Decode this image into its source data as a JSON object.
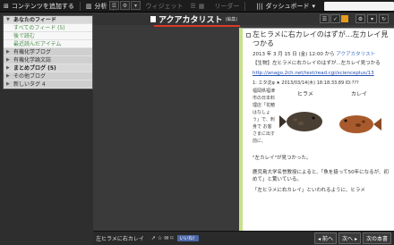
{
  "topbar": {
    "add_content": "コンテンツを追加する",
    "analytics": "分析",
    "widget": "ウィジェット",
    "reader": "リーダー",
    "dashboard": "ダッシュボード"
  },
  "sidebar": {
    "items": [
      {
        "label": "あなたのフィード",
        "style": "head"
      },
      {
        "label": "すべてのフィード (5)",
        "style": "plain"
      },
      {
        "label": "後で読む",
        "style": "plain"
      },
      {
        "label": "最近読んだアイテム",
        "style": "plain"
      },
      {
        "label": "有機化学ブログ",
        "style": "dark"
      },
      {
        "label": "有機化学論文誌",
        "style": "dark"
      },
      {
        "label": "まとめブログ (5)",
        "style": "head"
      },
      {
        "label": "その他ブログ",
        "style": "dark"
      },
      {
        "label": "新しいタグ 4",
        "style": "dark"
      }
    ]
  },
  "page_title": {
    "title": "アクアカタリスト",
    "edit": "(編集)"
  },
  "article": {
    "title": "左ヒラメに右カレイのはずが...左カレイ見つかる",
    "date": "2013 年 3 月 15 日 (金) 12:00",
    "from": "から",
    "source": "アクアカタリスト",
    "summary": "【生物】左ヒラメに右カレイのはずが...左カレイ見つかる",
    "link": "http://anago.2ch.net/test/read.cgi/scienceplus/13",
    "post_header": "1: エタ沈φ ★ 2013/03/14(木) 18:18:33.89 ID:???",
    "side_text": "福岡県福津市の日本料理店「花鰆はなしょう」で、刺身で お客さまに出す前に、",
    "fish_labels": [
      "ヒラメ",
      "カレイ"
    ],
    "caption": "\"左カレイ\"が見つかった。",
    "more_text": "鹿児島大学名誉教授によると、「魚を扱って50年になるが、初めて」と驚いている。",
    "more_text2": "「左ヒラメに右カレイ」といわれるように、ヒラメ"
  },
  "bottombar": {
    "share_title": "左ヒラメに右カレイ",
    "like": "いいね！",
    "prev": "前へ",
    "next": "次へ",
    "next_article": "次の本書"
  },
  "colors": {
    "accent_red": "#d93a2a",
    "link_green": "#2e8b2e",
    "orange": "#e89a1a"
  }
}
